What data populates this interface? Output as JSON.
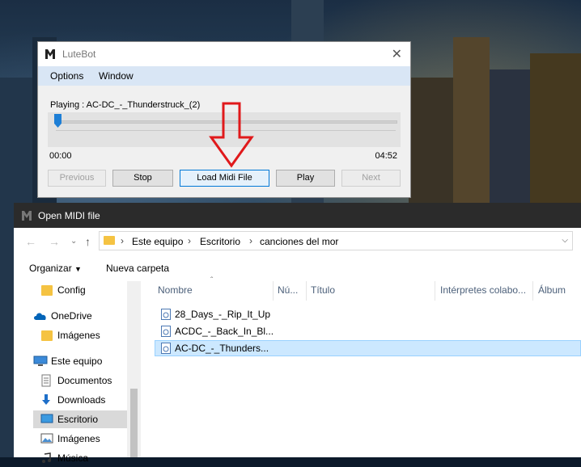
{
  "lutebot": {
    "title": "LuteBot",
    "close_glyph": "✕",
    "menu": [
      "Options",
      "Window"
    ],
    "playing_text": "Playing : AC-DC_-_Thunderstruck_(2)",
    "time_current": "00:00",
    "time_total": "04:52",
    "progress_fraction": 0.0,
    "buttons": {
      "previous": "Previous",
      "stop": "Stop",
      "load": "Load Midi File",
      "play": "Play",
      "next": "Next"
    }
  },
  "dialog": {
    "title": "Open MIDI file",
    "breadcrumb": [
      "Este equipo",
      "Escritorio",
      "canciones del mor"
    ],
    "toolbar": {
      "organize": "Organizar",
      "new_folder": "Nueva carpeta"
    },
    "nav_items": [
      {
        "label": "Config",
        "icon": "folder-icon"
      },
      {
        "label": "OneDrive",
        "icon": "onedrive-icon"
      },
      {
        "label": "Imágenes",
        "icon": "folder-icon"
      },
      {
        "label": "Este equipo",
        "icon": "computer-icon"
      },
      {
        "label": "Documentos",
        "icon": "documents-icon"
      },
      {
        "label": "Downloads",
        "icon": "download-icon"
      },
      {
        "label": "Escritorio",
        "icon": "desktop-icon"
      },
      {
        "label": "Imágenes",
        "icon": "pictures-icon"
      },
      {
        "label": "Música",
        "icon": "music-icon"
      }
    ],
    "columns": [
      "Nombre",
      "Nú...",
      "Título",
      "Intérpretes colabo...",
      "Álbum"
    ],
    "files": [
      "28_Days_-_Rip_It_Up",
      "ACDC_-_Back_In_Bl...",
      "AC-DC_-_Thunders..."
    ]
  },
  "colors": {
    "menu_bar": "#d9e6f5",
    "accent": "#0078d7",
    "slider_thumb": "#1e7fd6",
    "arrow": "#e0191b",
    "dialog_title_bar": "#2b2b2b",
    "selected_file": "#cce8ff"
  }
}
